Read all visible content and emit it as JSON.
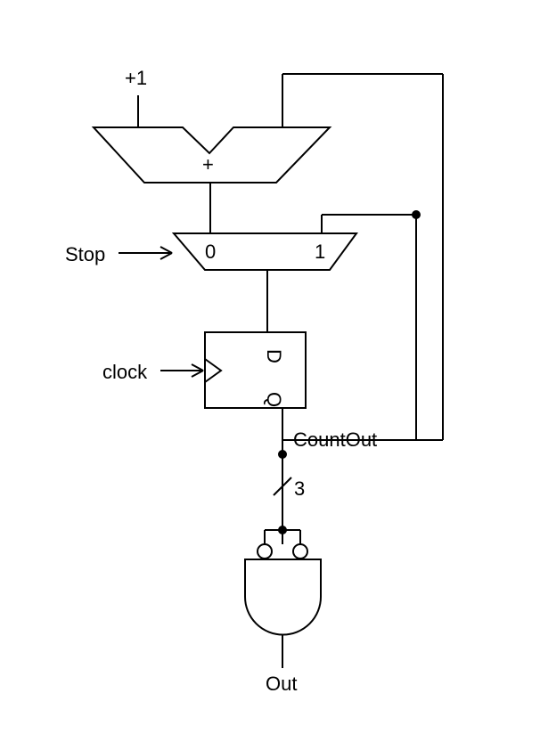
{
  "labels": {
    "plus_one": "+1",
    "adder_symbol": "+",
    "stop": "Stop",
    "mux_0": "0",
    "mux_1": "1",
    "reg_d": "D",
    "reg_q": "Q",
    "clock": "clock",
    "count_out": "CountOut",
    "bus_width": "3",
    "out": "Out"
  }
}
